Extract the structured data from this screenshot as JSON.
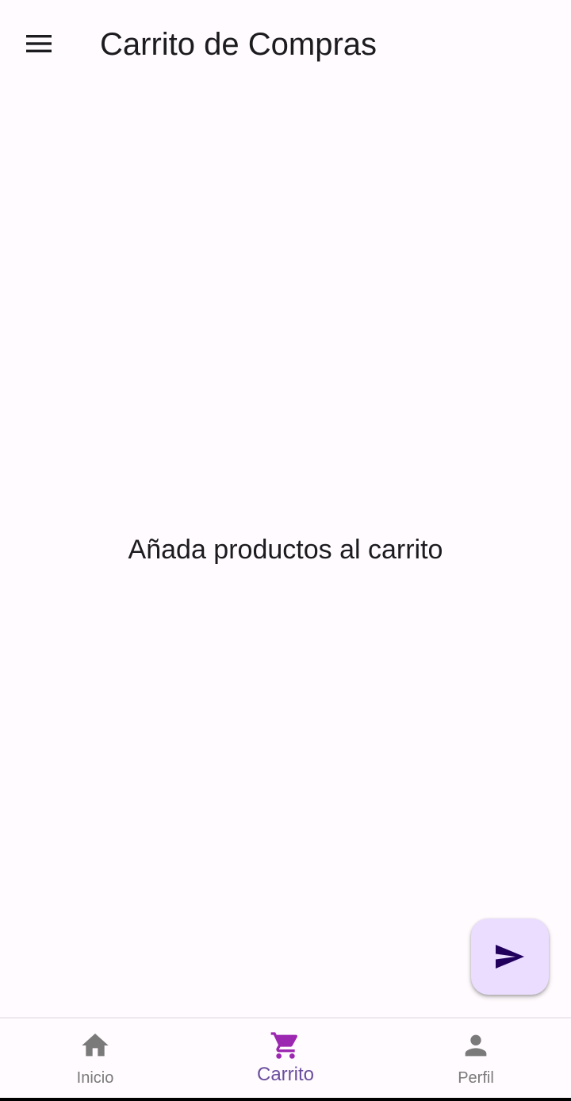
{
  "app_bar": {
    "title": "Carrito de Compras",
    "menu_icon": "menu-icon"
  },
  "main": {
    "empty_message": "Añada productos al carrito"
  },
  "fab": {
    "icon": "send-icon",
    "background": "#eaddff",
    "icon_color": "#21005d"
  },
  "bottom_nav": {
    "items": [
      {
        "label": "Inicio",
        "icon": "home-icon",
        "active": false
      },
      {
        "label": "Carrito",
        "icon": "shopping-cart-icon",
        "active": true
      },
      {
        "label": "Perfil",
        "icon": "person-icon",
        "active": false
      }
    ],
    "active_color": "#9c27b0",
    "inactive_color": "#7a7a7a"
  },
  "colors": {
    "background": "#fffbfe",
    "text": "#1c1b1f"
  }
}
